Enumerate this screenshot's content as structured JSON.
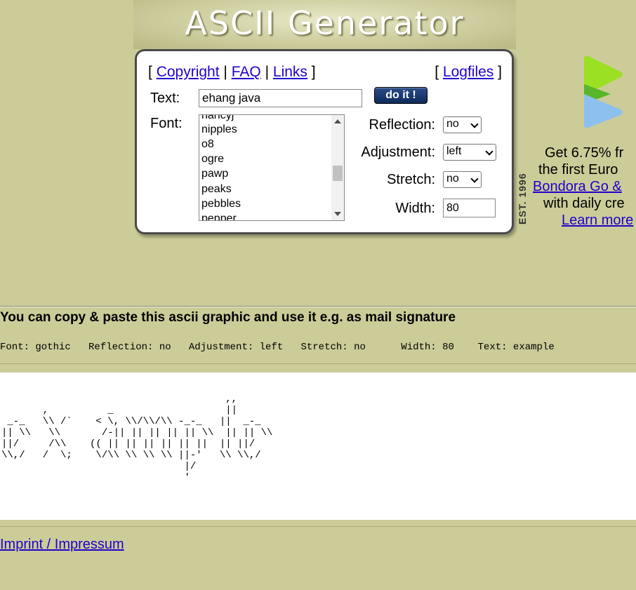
{
  "header": {
    "title": "ASCII Generator"
  },
  "nav": {
    "open_bracket": "[",
    "close_bracket": "]",
    "separator": "|",
    "copyright": "Copyright",
    "faq": "FAQ",
    "links": "Links",
    "logfiles": "Logfiles"
  },
  "form": {
    "text_label": "Text:",
    "text_value": "ehang java",
    "submit_label": "do it !",
    "font_label": "Font:",
    "font_list": [
      "nancyj",
      "nipples",
      "o8",
      "ogre",
      "pawp",
      "peaks",
      "pebbles",
      "pepper"
    ],
    "reflection_label": "Reflection:",
    "reflection_value": "no",
    "adjustment_label": "Adjustment:",
    "adjustment_value": "left",
    "stretch_label": "Stretch:",
    "stretch_value": "no",
    "width_label": "Width:",
    "width_value": "80"
  },
  "badge": "EST. 1996",
  "ad": {
    "line1": "Get 6.75% fr",
    "line2": "the first Euro",
    "link1": "Bondora Go & ",
    "line3": "with daily cre",
    "link2": "Learn more",
    "colors": {
      "logo_top": "#9be022",
      "logo_mid": "#59b52a",
      "logo_bottom": "#8ec0ee"
    }
  },
  "result": {
    "heading": "You can copy & paste this ascii graphic and use it e.g. as mail signature",
    "meta": "Font: gothic   Reflection: no   Adjustment: left   Stretch: no      Width: 80    Text: example",
    "ascii": "                                      ,,\n       ,          _                   ||\n _-_   \\\\ /`    < \\, \\\\/\\\\/\\\\ -_-_   ||  _-_\n|| \\\\   \\\\       /-|| || || || || \\\\  || || \\\\\n||/     /\\\\    (( || || || || || ||  || ||/\n\\\\,/   /  \\;    \\/\\\\ \\\\ \\\\ \\\\ ||-'   \\\\ \\\\,/\n                               |/\n                               '"
  },
  "footer": {
    "imprint": "Imprint / Impressum"
  }
}
